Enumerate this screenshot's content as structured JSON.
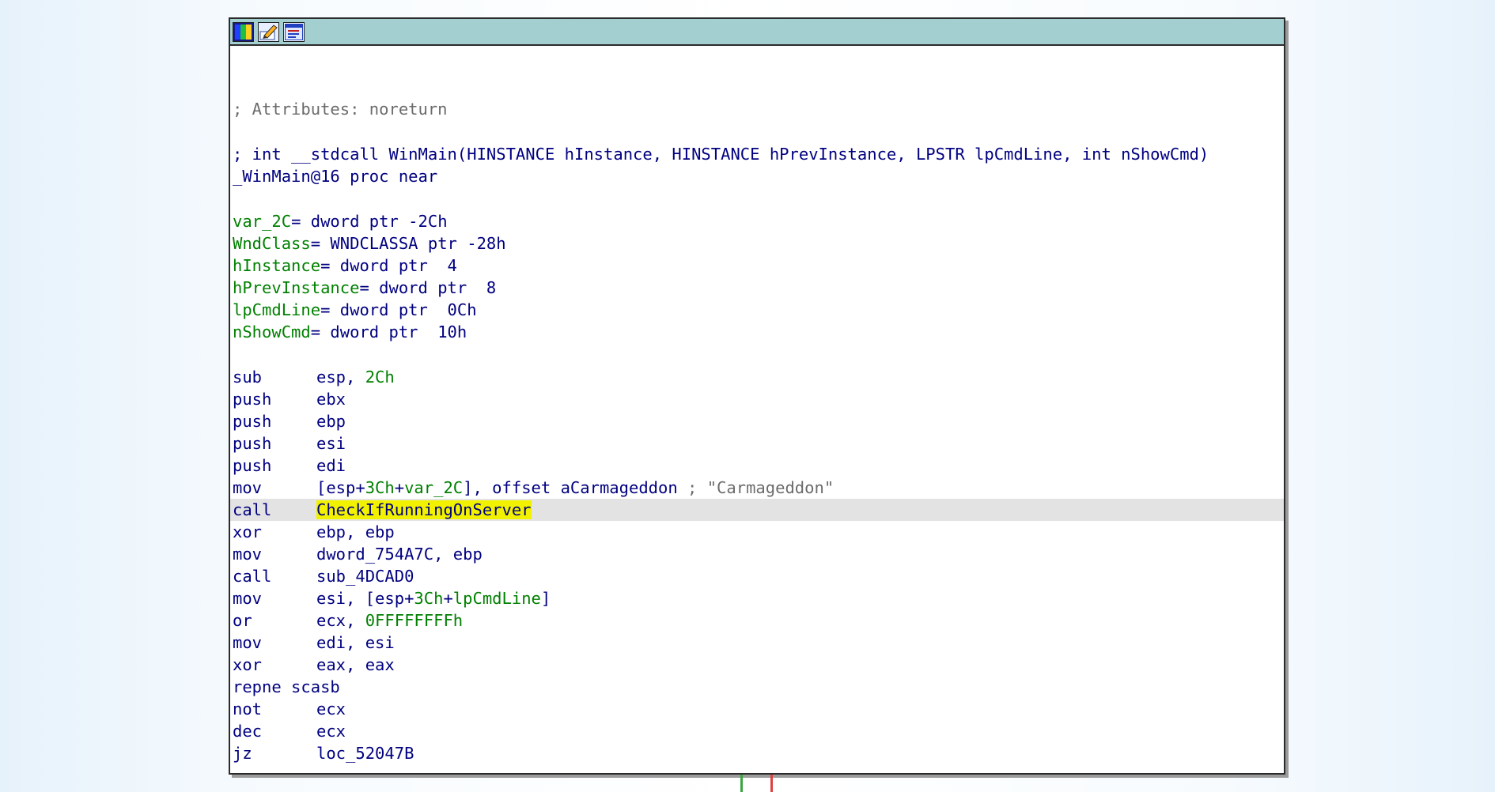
{
  "titlebar": {
    "icons": [
      "graph-colors-icon",
      "edit-node-icon",
      "node-list-icon"
    ]
  },
  "listing": {
    "attributes_comment": "; Attributes: noreturn",
    "signature_prefix": "; int __stdcall ",
    "signature_rest": "WinMain(HINSTANCE hInstance, HINSTANCE hPrevInstance, LPSTR lpCmdLine, int nShowCmd)",
    "proc_name": "_WinMain@16",
    "proc_decl": " proc near",
    "vars": [
      {
        "name": "var_2C",
        "decl": "= dword ptr -2Ch"
      },
      {
        "name": "WndClass",
        "decl": "= WNDCLASSA ptr -28h"
      },
      {
        "name": "hInstance",
        "decl": "= dword ptr  4"
      },
      {
        "name": "hPrevInstance",
        "decl": "= dword ptr  8"
      },
      {
        "name": "lpCmdLine",
        "decl": "= dword ptr  0Ch"
      },
      {
        "name": "nShowCmd",
        "decl": "= dword ptr  10h"
      }
    ],
    "instructions": [
      {
        "mnem": "sub",
        "ops": "esp, 2Ch"
      },
      {
        "mnem": "push",
        "ops": "ebx"
      },
      {
        "mnem": "push",
        "ops": "ebp"
      },
      {
        "mnem": "push",
        "ops": "esi"
      },
      {
        "mnem": "push",
        "ops": "edi"
      },
      {
        "mnem": "mov",
        "ops": "[esp+3Ch+var_2C], offset aCarmageddon",
        "comment": " ; \"Carmageddon\""
      },
      {
        "mnem": "call",
        "ops": "CheckIfRunningOnServer"
      },
      {
        "mnem": "xor",
        "ops": "ebp, ebp"
      },
      {
        "mnem": "mov",
        "ops": "dword_754A7C, ebp"
      },
      {
        "mnem": "call",
        "ops": "sub_4DCAD0"
      },
      {
        "mnem": "mov",
        "ops": "esi, [esp+3Ch+lpCmdLine]"
      },
      {
        "mnem": "or",
        "ops": "ecx, 0FFFFFFFFh"
      },
      {
        "mnem": "mov",
        "ops": "edi, esi"
      },
      {
        "mnem": "xor",
        "ops": "eax, eax"
      },
      {
        "mnem": "repne scasb",
        "ops": ""
      },
      {
        "mnem": "not",
        "ops": "ecx"
      },
      {
        "mnem": "dec",
        "ops": "ecx"
      },
      {
        "mnem": "jz",
        "ops": "loc_52047B"
      }
    ]
  },
  "colors": {
    "titlebar": "#a3cfd1",
    "highlight_line": "#e3e3e3",
    "highlight_token": "#f2f200",
    "code_blue": "#000080",
    "code_green": "#008000",
    "comment_gray": "#6b6b6b",
    "edge_green": "#3aa640",
    "edge_red": "#e04040"
  }
}
